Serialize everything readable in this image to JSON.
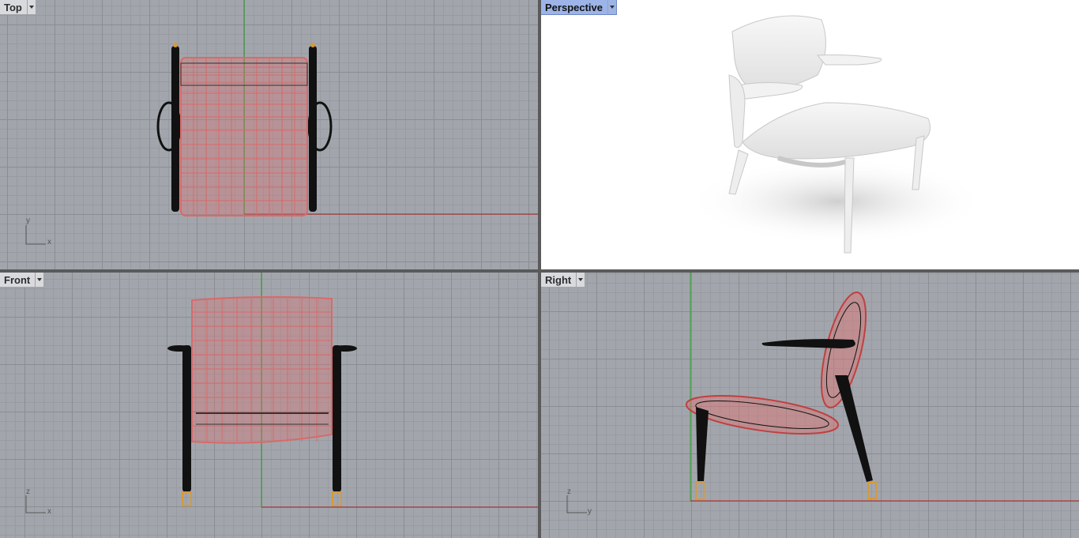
{
  "viewports": {
    "top": {
      "label": "Top",
      "axis_v": "y",
      "axis_h": "x"
    },
    "perspective": {
      "label": "Perspective"
    },
    "front": {
      "label": "Front",
      "axis_v": "z",
      "axis_h": "x"
    },
    "right": {
      "label": "Right",
      "axis_v": "z",
      "axis_h": "y"
    }
  },
  "colors": {
    "grid_bg": "#a2a6ac",
    "x_axis": "#b02020",
    "y_axis": "#1ea01e",
    "selection": "#e07070",
    "active_tab": "#9cb4e8"
  },
  "icons": [
    "dropdown-arrow-icon",
    "axis-indicator-icon"
  ]
}
